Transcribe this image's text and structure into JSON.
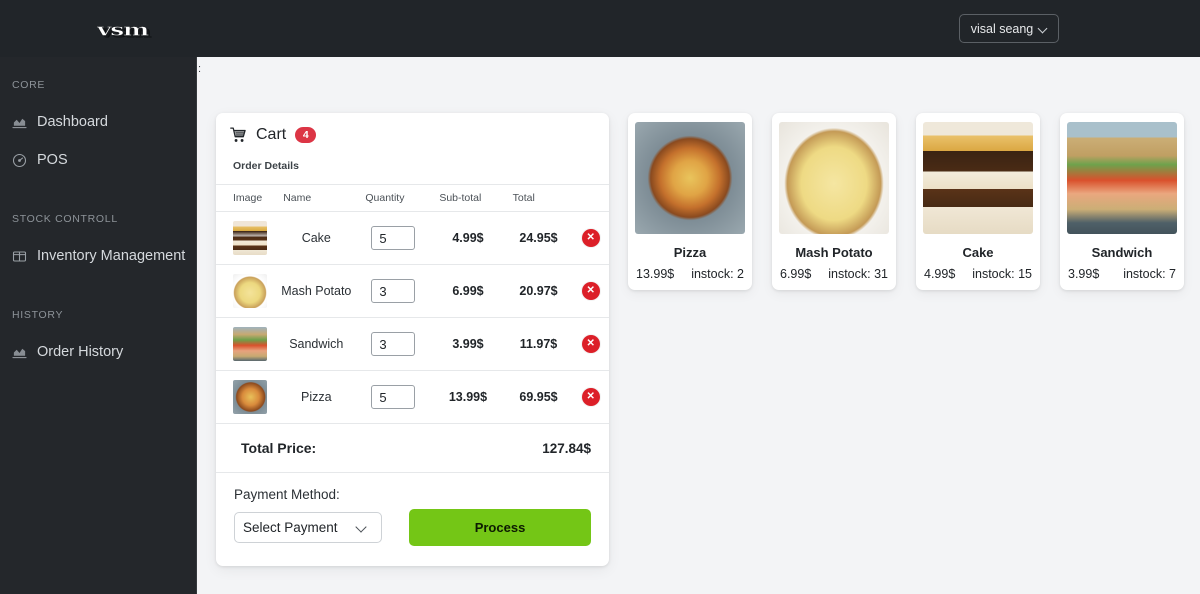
{
  "topbar": {
    "logo": "vsm",
    "user_menu": {
      "label": "visal seang",
      "icon": "chevron-down-icon"
    }
  },
  "sidebar": {
    "sections": [
      {
        "label": "CORE",
        "items": [
          {
            "label": "Dashboard",
            "icon": "chart-icon"
          },
          {
            "label": "POS",
            "icon": "gauge-icon"
          }
        ]
      },
      {
        "label": "STOCK CONTROLL",
        "items": [
          {
            "label": "Inventory Management",
            "icon": "table-columns-icon"
          }
        ]
      },
      {
        "label": "HISTORY",
        "items": [
          {
            "label": "Order History",
            "icon": "chart-icon"
          }
        ]
      }
    ]
  },
  "main": {
    "clipped_text": ":"
  },
  "cart": {
    "title": "Cart",
    "icon": "shopping-cart-icon",
    "badge": "4",
    "subtitle": "Order Details",
    "columns": [
      "Image",
      "Name",
      "Quantity",
      "Sub-total",
      "Total"
    ],
    "rows": [
      {
        "name": "Cake",
        "quantity": "5",
        "subtotal": "4.99$",
        "total": "24.95$",
        "image": "cake-thumbnail",
        "delete_icon": "close-icon"
      },
      {
        "name": "Mash Potato",
        "quantity": "3",
        "subtotal": "6.99$",
        "total": "20.97$",
        "image": "mash-potato-thumbnail",
        "delete_icon": "close-icon"
      },
      {
        "name": "Sandwich",
        "quantity": "3",
        "subtotal": "3.99$",
        "total": "11.97$",
        "image": "sandwich-thumbnail",
        "delete_icon": "close-icon"
      },
      {
        "name": "Pizza",
        "quantity": "5",
        "subtotal": "13.99$",
        "total": "69.95$",
        "image": "pizza-thumbnail",
        "delete_icon": "close-icon"
      }
    ],
    "total_label": "Total Price:",
    "total_value": "127.84$",
    "payment_label": "Payment Method:",
    "payment_selected": "Select Payment",
    "process_label": "Process"
  },
  "products": [
    {
      "name": "Pizza",
      "price": "13.99$",
      "stock": "instock: 2",
      "image": "pizza-image"
    },
    {
      "name": "Mash Potato",
      "price": "6.99$",
      "stock": "instock: 31",
      "image": "mash-potato-image"
    },
    {
      "name": "Cake",
      "price": "4.99$",
      "stock": "instock: 15",
      "image": "cake-image"
    },
    {
      "name": "Sandwich",
      "price": "3.99$",
      "stock": "instock: 7",
      "image": "sandwich-image"
    }
  ],
  "colors": {
    "topbar_bg": "#212529",
    "sidebar_bg": "#24272b",
    "page_bg": "#f3f4f6",
    "badge_red": "#dc3545",
    "delete_red": "#dc1f28",
    "process_green": "#74c616"
  }
}
